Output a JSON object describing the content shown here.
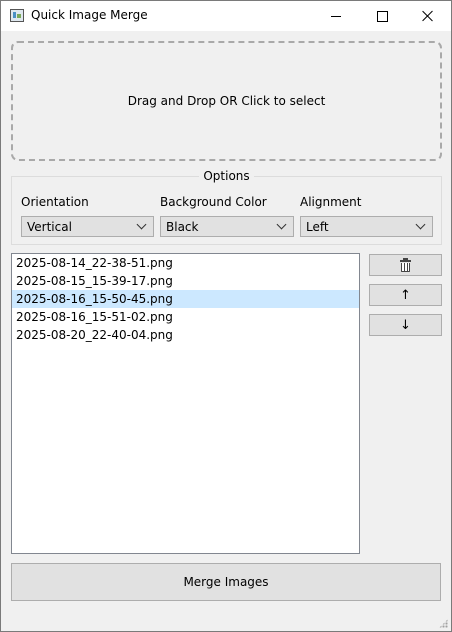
{
  "window": {
    "title": "Quick Image Merge"
  },
  "dropzone": {
    "text": "Drag and Drop OR Click to select"
  },
  "options": {
    "title": "Options",
    "orientation": {
      "label": "Orientation",
      "value": "Vertical"
    },
    "background": {
      "label": "Background Color",
      "value": "Black"
    },
    "alignment": {
      "label": "Alignment",
      "value": "Left"
    }
  },
  "files": [
    {
      "name": "2025-08-14_22-38-51.png",
      "selected": false
    },
    {
      "name": "2025-08-15_15-39-17.png",
      "selected": false
    },
    {
      "name": "2025-08-16_15-50-45.png",
      "selected": true
    },
    {
      "name": "2025-08-16_15-51-02.png",
      "selected": false
    },
    {
      "name": "2025-08-20_22-40-04.png",
      "selected": false
    }
  ],
  "buttons": {
    "delete_icon": "trash-icon",
    "up_label": "↑",
    "down_label": "↓",
    "merge_label": "Merge Images"
  },
  "colors": {
    "selection": "#cce8ff",
    "button_bg": "#e1e1e1",
    "window_bg": "#f0f0f0"
  }
}
